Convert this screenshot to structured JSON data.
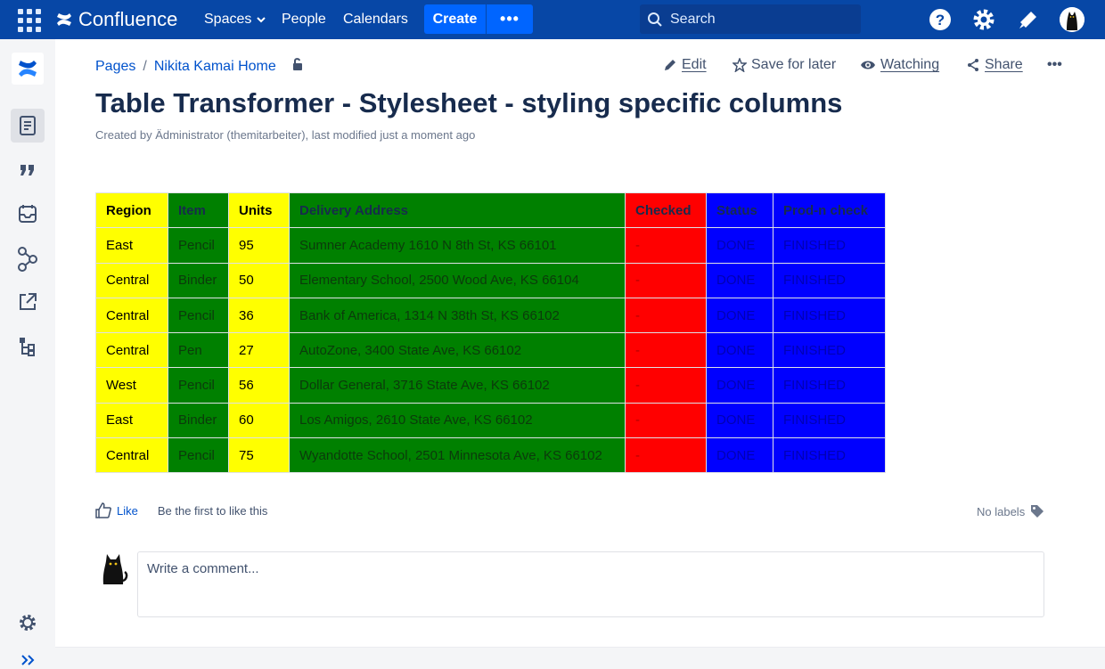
{
  "topnav": {
    "app_name": "Confluence",
    "spaces": "Spaces",
    "people": "People",
    "calendars": "Calendars",
    "create": "Create",
    "create_more": "•••",
    "search_placeholder": "Search"
  },
  "breadcrumb": {
    "pages": "Pages",
    "separator": "/",
    "home": "Nikita Kamai Home"
  },
  "actions": {
    "edit": "Edit",
    "save_for_later": "Save for later",
    "watching": "Watching",
    "share": "Share",
    "more": "•••"
  },
  "page": {
    "title": "Table Transformer - Stylesheet - styling specific columns",
    "byline_prefix": "Created by Ädministrator (themitarbeiter), last modified ",
    "byline_time": "just a moment ago"
  },
  "table": {
    "headers": [
      "Region",
      "Item",
      "Units",
      "Delivery Address",
      "Checked",
      "Status",
      "Prod-n check"
    ],
    "rows": [
      [
        "East",
        "Pencil",
        "95",
        "Sumner Academy 1610 N 8th St, KS 66101",
        "-",
        "DONE",
        "FINISHED"
      ],
      [
        "Central",
        "Binder",
        "50",
        "Elementary School, 2500 Wood Ave, KS 66104",
        "-",
        "DONE",
        "FINISHED"
      ],
      [
        "Central",
        "Pencil",
        "36",
        "Bank of America, 1314 N 38th St, KS 66102",
        "-",
        "DONE",
        "FINISHED"
      ],
      [
        "Central",
        "Pen",
        "27",
        "AutoZone, 3400 State Ave, KS 66102",
        "-",
        "DONE",
        "FINISHED"
      ],
      [
        "West",
        "Pencil",
        "56",
        "Dollar General, 3716 State Ave, KS 66102",
        "-",
        "DONE",
        "FINISHED"
      ],
      [
        "East",
        "Binder",
        "60",
        "Los Amigos, 2610 State Ave, KS 66102",
        "-",
        "DONE",
        "FINISHED"
      ],
      [
        "Central",
        "Pencil",
        "75",
        " Wyandotte School, 2501 Minnesota Ave, KS 66102",
        "-",
        "DONE",
        "FINISHED"
      ]
    ],
    "column_colors": [
      "#FFFF00",
      "#008000",
      "#FFFF00",
      "#008000",
      "#FF0000",
      "#0000FF",
      "#0000FF"
    ]
  },
  "footer": {
    "like": "Like",
    "like_text": "Be the first to like this",
    "no_labels": "No labels",
    "comment_placeholder": "Write a comment..."
  },
  "colors": {
    "nav_bg": "#0747A6",
    "create_bg": "#0065FF",
    "link": "#0052CC"
  }
}
